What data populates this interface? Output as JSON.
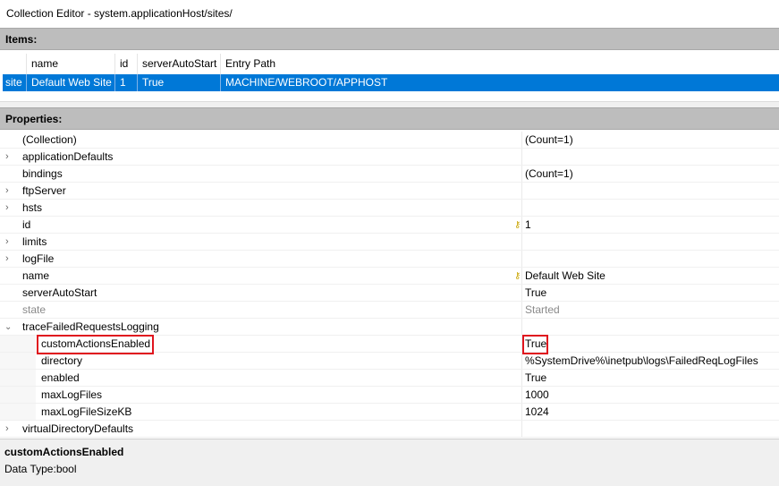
{
  "window": {
    "title": "Collection Editor - system.applicationHost/sites/"
  },
  "items_section": {
    "header": "Items:",
    "columns": [
      "name",
      "id",
      "serverAutoStart",
      "Entry Path"
    ],
    "rows": [
      {
        "type": "site",
        "name": "Default Web Site",
        "id": "1",
        "serverAutoStart": "True",
        "entry_path": "MACHINE/WEBROOT/APPHOST"
      }
    ]
  },
  "properties_section": {
    "header": "Properties:",
    "rows": [
      {
        "name": "(Collection)",
        "value": "(Count=1)",
        "expandable": false
      },
      {
        "name": "applicationDefaults",
        "value": "",
        "expandable": true
      },
      {
        "name": "bindings",
        "value": "(Count=1)",
        "expandable": false
      },
      {
        "name": "ftpServer",
        "value": "",
        "expandable": true
      },
      {
        "name": "hsts",
        "value": "",
        "expandable": true
      },
      {
        "name": "id",
        "value": "1",
        "expandable": false,
        "key": true
      },
      {
        "name": "limits",
        "value": "",
        "expandable": true
      },
      {
        "name": "logFile",
        "value": "",
        "expandable": true
      },
      {
        "name": "name",
        "value": "Default Web Site",
        "expandable": false,
        "key": true
      },
      {
        "name": "serverAutoStart",
        "value": "True",
        "expandable": false
      },
      {
        "name": "state",
        "value": "Started",
        "expandable": false,
        "readonly": true
      },
      {
        "name": "traceFailedRequestsLogging",
        "value": "",
        "expanded": true
      },
      {
        "name": "customActionsEnabled",
        "value": "True",
        "child": true,
        "highlighted": true
      },
      {
        "name": "directory",
        "value": "%SystemDrive%\\inetpub\\logs\\FailedReqLogFiles",
        "child": true
      },
      {
        "name": "enabled",
        "value": "True",
        "child": true
      },
      {
        "name": "maxLogFiles",
        "value": "1000",
        "child": true
      },
      {
        "name": "maxLogFileSizeKB",
        "value": "1024",
        "child": true
      },
      {
        "name": "virtualDirectoryDefaults",
        "value": "",
        "expandable": true
      }
    ]
  },
  "description": {
    "title": "customActionsEnabled",
    "text": "Data Type:bool"
  },
  "colors": {
    "selection": "#0078d7",
    "highlight_box": "#e0141e",
    "header_band": "#bdbdbd"
  },
  "icons": {
    "expand": "chevron-right-icon",
    "collapse": "chevron-down-icon",
    "key": "key-icon"
  }
}
